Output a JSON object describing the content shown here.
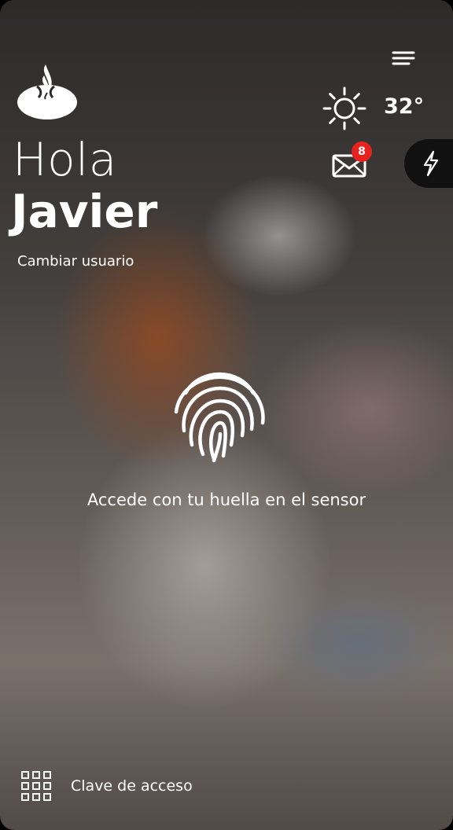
{
  "greeting": {
    "hello": "Hola",
    "name": "Javier",
    "switch_user": "Cambiar usuario"
  },
  "weather": {
    "icon": "sun-icon",
    "temperature": "32°"
  },
  "notifications": {
    "icon": "mail-icon",
    "count": "8"
  },
  "quick_action": {
    "icon": "lightning-icon"
  },
  "fingerprint": {
    "icon": "fingerprint-icon",
    "message": "Accede con tu huella en el sensor"
  },
  "footer": {
    "icon": "keypad-grid-icon",
    "access_label": "Clave de acceso"
  },
  "colors": {
    "badge": "#e8231f",
    "text": "#ffffff",
    "quick_action_bg": "#111111"
  }
}
